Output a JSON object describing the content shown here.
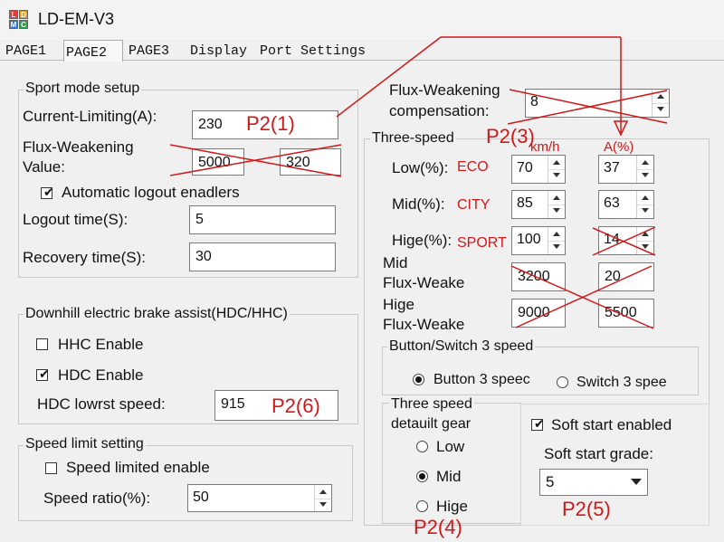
{
  "app": {
    "title": "LD-EM-V3",
    "icon_letters": [
      "L",
      "D",
      "M",
      "C"
    ]
  },
  "tabs": [
    "PAGE1",
    "PAGE2",
    "PAGE3",
    "Display",
    "Port Settings"
  ],
  "sport": {
    "title": "Sport mode setup",
    "current_label": "Current-Limiting(A):",
    "current_value": "230",
    "flux_label_1": "Flux-Weakening",
    "flux_label_2": "Value:",
    "flux_value_1": "5000",
    "flux_value_2": "320",
    "auto_logout_label": "Automatic logout enadlers",
    "auto_logout_checked": true,
    "logout_label": "Logout time(S):",
    "logout_value": "5",
    "recovery_label": "Recovery time(S):",
    "recovery_value": "30"
  },
  "downhill": {
    "title": "Downhill electric brake assist(HDC/HHC)",
    "hhc_label": "HHC Enable",
    "hhc_checked": false,
    "hdc_label": "HDC Enable",
    "hdc_checked": true,
    "speed_label": "HDC lowrst speed:",
    "speed_value": "915"
  },
  "speedlimit": {
    "title": "Speed limit setting",
    "enable_label": "Speed limited enable",
    "enable_checked": false,
    "ratio_label": "Speed ratio(%):",
    "ratio_value": "50"
  },
  "flux_comp": {
    "label_1": "Flux-Weakening",
    "label_2": "compensation:",
    "value": "8"
  },
  "three_speed": {
    "title": "Three-speed",
    "low_label": "Low(%):",
    "low_kmh": "70",
    "low_a": "37",
    "mid_label": "Mid(%):",
    "mid_kmh": "85",
    "mid_a": "63",
    "high_label": "Hige(%):",
    "high_kmh": "100",
    "high_a": "14",
    "midflux_label_1": "Mid",
    "midflux_label_2": "Flux-Weake",
    "midflux_v1": "3200",
    "midflux_v2": "20",
    "higeflux_label_1": "Hige",
    "higeflux_label_2": "Flux-Weake",
    "higeflux_v1": "9000",
    "higeflux_v2": "5500"
  },
  "button_switch": {
    "title": "Button/Switch 3 speed",
    "button_label": "Button 3 speec",
    "switch_label": "Switch 3 spee",
    "selected": "button"
  },
  "default_gear": {
    "title_1": "Three speed",
    "title_2": "detauilt gear",
    "options": [
      "Low",
      "Mid",
      "Hige"
    ],
    "selected": "Mid"
  },
  "soft_start": {
    "enabled_label": "Soft start enabled",
    "enabled_checked": true,
    "grade_label": "Soft start grade:",
    "grade_value": "5"
  },
  "annotations": {
    "p2_1": "P2(1)",
    "p2_3": "P2(3)",
    "p2_4": "P2(4)",
    "p2_5": "P2(5)",
    "p2_6": "P2(6)",
    "kmh": "km/h",
    "amp": "A(%)",
    "eco": "ECO",
    "city": "CITY",
    "sport": "SPORT",
    "color": "#d01818"
  }
}
